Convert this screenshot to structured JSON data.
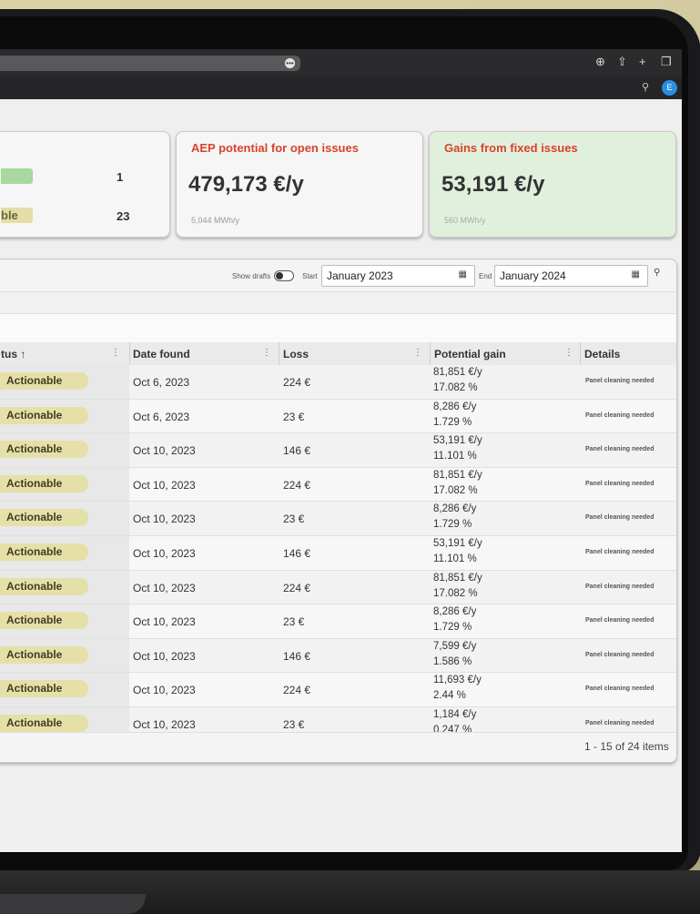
{
  "browser": {
    "avatar_letter": "E",
    "icons": [
      "download-icon",
      "share-icon",
      "new-tab-icon",
      "tabs-icon"
    ]
  },
  "cards": {
    "status_counts": [
      {
        "label": "",
        "count": "1",
        "color": "#a8d8a0"
      },
      {
        "label": "ble",
        "count": "23",
        "color": "#e3dea5"
      }
    ],
    "aep": {
      "title": "AEP potential for open issues",
      "value": "479,173 €/y",
      "sub": "5,044 MWh/y"
    },
    "gains": {
      "title": "Gains from fixed issues",
      "value": "53,191 €/y",
      "sub": "560 MWh/y"
    }
  },
  "toolbar": {
    "show_drafts": "Show drafts",
    "start_label": "Start",
    "start_value": "January 2023",
    "end_label": "End",
    "end_value": "January 2024"
  },
  "table": {
    "headers": {
      "status": "tus ↑",
      "date": "Date found",
      "loss": "Loss",
      "gain": "Potential gain",
      "details": "Details"
    },
    "rows": [
      {
        "status": "Actionable",
        "date": "Oct 6, 2023",
        "loss": "224 €",
        "gain": "81,851 €/y",
        "pct": "17.082 %",
        "details": "Panel cleaning needed"
      },
      {
        "status": "Actionable",
        "date": "Oct 6, 2023",
        "loss": "23 €",
        "gain": "8,286 €/y",
        "pct": "1.729 %",
        "details": "Panel cleaning needed"
      },
      {
        "status": "Actionable",
        "date": "Oct 10, 2023",
        "loss": "146 €",
        "gain": "53,191 €/y",
        "pct": "11.101 %",
        "details": "Panel cleaning needed"
      },
      {
        "status": "Actionable",
        "date": "Oct 10, 2023",
        "loss": "224 €",
        "gain": "81,851 €/y",
        "pct": "17.082 %",
        "details": "Panel cleaning needed"
      },
      {
        "status": "Actionable",
        "date": "Oct 10, 2023",
        "loss": "23 €",
        "gain": "8,286 €/y",
        "pct": "1.729 %",
        "details": "Panel cleaning needed"
      },
      {
        "status": "Actionable",
        "date": "Oct 10, 2023",
        "loss": "146 €",
        "gain": "53,191 €/y",
        "pct": "11.101 %",
        "details": "Panel cleaning needed"
      },
      {
        "status": "Actionable",
        "date": "Oct 10, 2023",
        "loss": "224 €",
        "gain": "81,851 €/y",
        "pct": "17.082 %",
        "details": "Panel cleaning needed"
      },
      {
        "status": "Actionable",
        "date": "Oct 10, 2023",
        "loss": "23 €",
        "gain": "8,286 €/y",
        "pct": "1.729 %",
        "details": "Panel cleaning needed"
      },
      {
        "status": "Actionable",
        "date": "Oct 10, 2023",
        "loss": "146 €",
        "gain": "7,599 €/y",
        "pct": "1.586 %",
        "details": "Panel cleaning needed"
      },
      {
        "status": "Actionable",
        "date": "Oct 10, 2023",
        "loss": "224 €",
        "gain": "11,693 €/y",
        "pct": "2.44 %",
        "details": "Panel cleaning needed"
      },
      {
        "status": "Actionable",
        "date": "Oct 10, 2023",
        "loss": "23 €",
        "gain": "1,184 €/y",
        "pct": "0.247 %",
        "details": "Panel cleaning needed"
      }
    ],
    "pager": "1 - 15 of 24 items"
  }
}
